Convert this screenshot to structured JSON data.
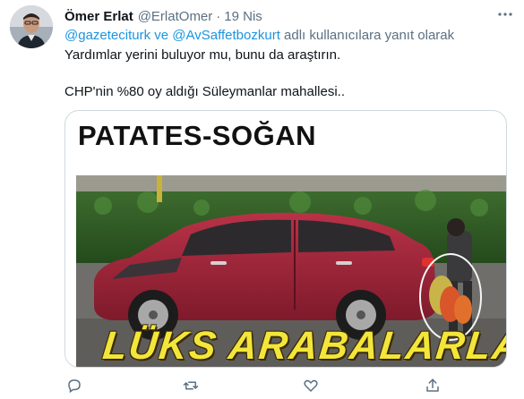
{
  "tweet": {
    "author_name": "Ömer Erlat",
    "author_handle": "@ErlatOmer",
    "separator": "·",
    "date": "19 Nis",
    "reply_to": {
      "mention_1": "@gazeteciturk",
      "conjunction": " ve ",
      "mention_2": "@AvSaffetbozkurt",
      "suffix": " adlı kullanıcılara yanıt olarak"
    },
    "text_line_1": "Yardımlar yerini buluyor mu, bunu da araştırın.",
    "text_line_2": "CHP'nin %80 oy aldığı Süleymanlar mahallesi..",
    "media": {
      "headline": "PATATES-SOĞAN",
      "overlay_caption": "LÜKS ARABALARLA"
    }
  },
  "icons": {
    "more": "more-options-icon",
    "reply": "reply-icon",
    "retweet": "retweet-icon",
    "like": "heart-icon",
    "share": "share-icon"
  },
  "colors": {
    "link": "#1b95e0",
    "secondary_text": "#5b7083",
    "primary_text": "#0f1419",
    "car": "#a0253a",
    "overlay_text": "#f3e63a"
  }
}
